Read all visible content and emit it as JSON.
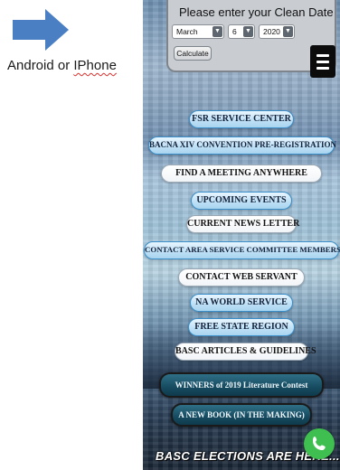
{
  "annotation": {
    "arrow_color": "#4a7fc4",
    "caption_prefix": "Android or ",
    "caption_word": "IPhone"
  },
  "clean_date": {
    "title": "Please enter your Clean Date",
    "month": "March",
    "day": "6",
    "year": "2020",
    "calculate_label": "Calculate"
  },
  "menu_icon": "hamburger-menu-icon",
  "nav_buttons": [
    {
      "label": "FSR SERVICE CENTER",
      "style": "blue"
    },
    {
      "label": "BACNA XIV CONVENTION PRE-REGISTRATION",
      "style": "blue"
    },
    {
      "label": "FIND A MEETING ANYWHERE",
      "style": "white"
    },
    {
      "label": "UPCOMING EVENTS",
      "style": "blue"
    },
    {
      "label": "CURRENT NEWS LETTER",
      "style": "white"
    },
    {
      "label": "CONTACT AREA SERVICE COMMITTEE MEMBERS",
      "style": "blue"
    },
    {
      "label": "CONTACT WEB SERVANT",
      "style": "white"
    },
    {
      "label": "NA WORLD SERVICE",
      "style": "blue"
    },
    {
      "label": "FREE STATE REGION",
      "style": "blue"
    },
    {
      "label": "BASC ARTICLES & GUIDELINES",
      "style": "white"
    }
  ],
  "dark_buttons": [
    {
      "label": "WINNERS of 2019 Literature Contest"
    },
    {
      "label": "A NEW BOOK (IN THE MAKING)"
    }
  ],
  "banner": "BASC ELECTIONS ARE HERE...!!",
  "phone_fab_icon": "phone-icon"
}
